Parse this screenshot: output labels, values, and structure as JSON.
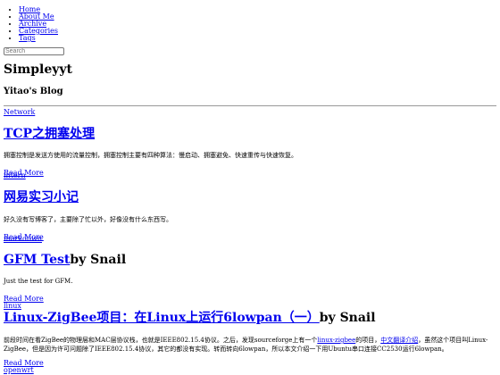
{
  "nav": [
    "Home",
    "About Me",
    "Archive",
    "Categories",
    "Tags"
  ],
  "search": {
    "placeholder": "Search"
  },
  "site": {
    "title": "Simpleyyt",
    "subtitle": "Yitao's Blog"
  },
  "posts": [
    {
      "category": "Network",
      "title": "TCP之拥塞处理",
      "byline": "",
      "excerpt": "拥塞控制是发送方使用的流量控制，拥塞控制主要有四种算法：慢启动、拥塞避免、快速重传与快速恢复。",
      "more": "Read More"
    },
    {
      "category": "intern",
      "title": "网易实习小记",
      "byline": "",
      "excerpt": "好久没有写博客了，主要除了忙以外，好像没有什么东西写。",
      "more": "Read More"
    },
    {
      "category": "markdown",
      "title": "GFM Test",
      "byline": "by Snail",
      "excerpt": "Just the test for GFM.",
      "more": "Read More"
    },
    {
      "category": "linux",
      "title": "Linux-ZigBee项目：在Linux上运行6lowpan（一）",
      "byline": "by Snail",
      "excerpt_parts": [
        "前段时间在看ZigBee的物理层和MAC层协议栈，也就是IEEE802.15.4协议。之后，发现sourceforge上有一个",
        "linux-zigbee",
        "的项目，",
        "中文翻译介绍",
        "，虽然这个项目叫Linux-ZigBee，但是因为许可问题除了IEEE802.15.4协议，其它的都没有实现。转而转向6lowpan，所以本文介绍一下用Ubuntu串口连接CC2530运行6lowpan。"
      ],
      "more": "Read More"
    }
  ],
  "next_category": "openwrt"
}
